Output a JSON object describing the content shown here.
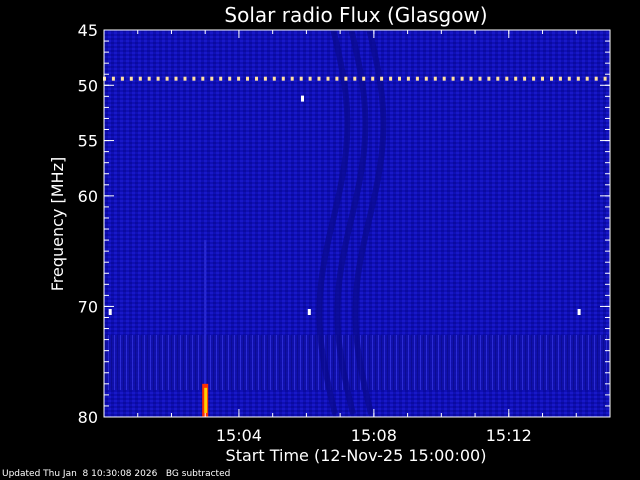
{
  "chart_data": {
    "type": "heatmap",
    "title": "Solar radio Flux (Glasgow)",
    "xlabel": "Start Time (12-Nov-25 15:00:00)",
    "ylabel": "Frequency [MHz]",
    "x_unit": "minutes after 15:00:00",
    "xlim": [
      0,
      15
    ],
    "ylim": [
      45,
      80
    ],
    "y_axis_inverted": true,
    "x_ticks": [
      {
        "value": 4,
        "label": "15:04"
      },
      {
        "value": 8,
        "label": "15:08"
      },
      {
        "value": 12,
        "label": "15:12"
      }
    ],
    "y_ticks": [
      {
        "value": 45,
        "label": "45"
      },
      {
        "value": 50,
        "label": "50"
      },
      {
        "value": 55,
        "label": "55"
      },
      {
        "value": 60,
        "label": "60"
      },
      {
        "value": 70,
        "label": "70"
      },
      {
        "value": 80,
        "label": "80"
      }
    ],
    "colors": {
      "background": "#0f0fb4",
      "interference_line": "#ffe0a0",
      "burst": "#ff3000",
      "burst_core": "#ffd000",
      "frame": "#ffffff"
    },
    "features": [
      {
        "name": "interference",
        "frequency_mhz": 49.4,
        "x_start": 0,
        "x_end": 15
      },
      {
        "name": "burst",
        "time_min": 3.0,
        "frequency_range_mhz": [
          77,
          80
        ]
      },
      {
        "name": "spot",
        "time_min": 5.9,
        "frequency_mhz": 51.2
      },
      {
        "name": "spot",
        "time_min": 0.2,
        "frequency_mhz": 70.5
      },
      {
        "name": "spot",
        "time_min": 6.1,
        "frequency_mhz": 70.5
      },
      {
        "name": "spot",
        "time_min": 14.1,
        "frequency_mhz": 70.5
      }
    ]
  },
  "footer": {
    "updated": "Updated Thu Jan  8 10:30:08 2026",
    "note": "BG subtracted"
  }
}
